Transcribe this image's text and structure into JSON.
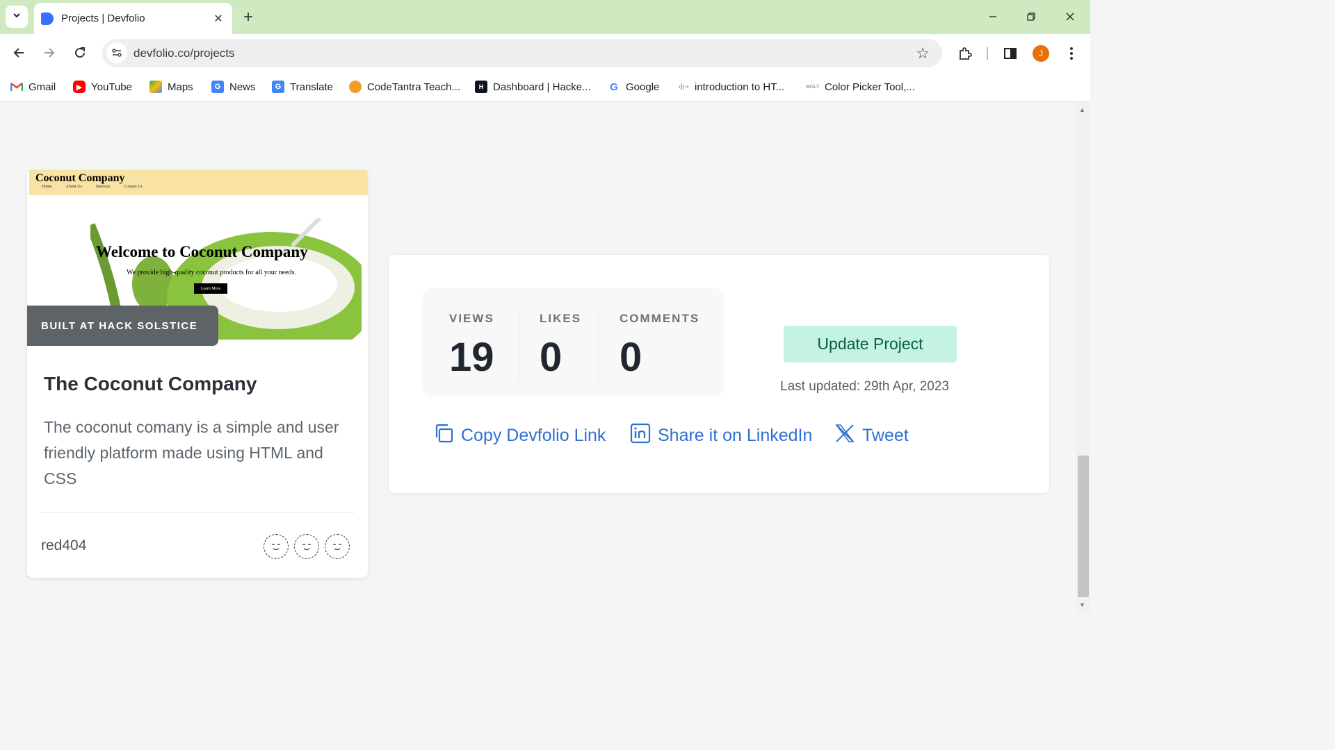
{
  "browser": {
    "tab_title": "Projects | Devfolio",
    "url": "devfolio.co/projects",
    "avatar_letter": "J",
    "bookmarks": [
      {
        "label": "Gmail",
        "icon": "gmail-icon"
      },
      {
        "label": "YouTube",
        "icon": "youtube-icon"
      },
      {
        "label": "Maps",
        "icon": "maps-icon"
      },
      {
        "label": "News",
        "icon": "news-icon"
      },
      {
        "label": "Translate",
        "icon": "translate-icon"
      },
      {
        "label": "CodeTantra Teach...",
        "icon": "codetantra-icon"
      },
      {
        "label": "Dashboard | Hacke...",
        "icon": "hackerrank-icon"
      },
      {
        "label": "Google",
        "icon": "google-icon"
      },
      {
        "label": "introduction to HT...",
        "icon": "audio-wave-icon"
      },
      {
        "label": "Color Picker Tool,...",
        "icon": "bolt-icon"
      }
    ]
  },
  "project_card": {
    "thumbnail": {
      "brand": "Coconut Company",
      "nav": [
        "Home",
        "About Us",
        "Services",
        "Contact Us"
      ],
      "hero_title": "Welcome to Coconut Company",
      "hero_subtitle": "We provide high-quality coconut products for all your needs.",
      "hero_button": "Learn More"
    },
    "badge": "BUILT AT HACK SOLSTICE",
    "title": "The Coconut Company",
    "description": "The coconut comany is a simple and user friendly platform made using HTML and CSS",
    "username": "red404"
  },
  "stats_panel": {
    "stats": [
      {
        "label": "VIEWS",
        "value": "19"
      },
      {
        "label": "LIKES",
        "value": "0"
      },
      {
        "label": "COMMENTS",
        "value": "0"
      }
    ],
    "update_button": "Update Project",
    "last_updated": "Last updated: 29th Apr, 2023",
    "share_links": {
      "copy": "Copy Devfolio Link",
      "linkedin": "Share it on LinkedIn",
      "tweet": "Tweet"
    }
  },
  "colors": {
    "titlebar": "#cfe9c1",
    "link_blue": "#2f6fd3",
    "update_button_bg": "#c5f3e2",
    "badge_bg": "#5e6368"
  }
}
